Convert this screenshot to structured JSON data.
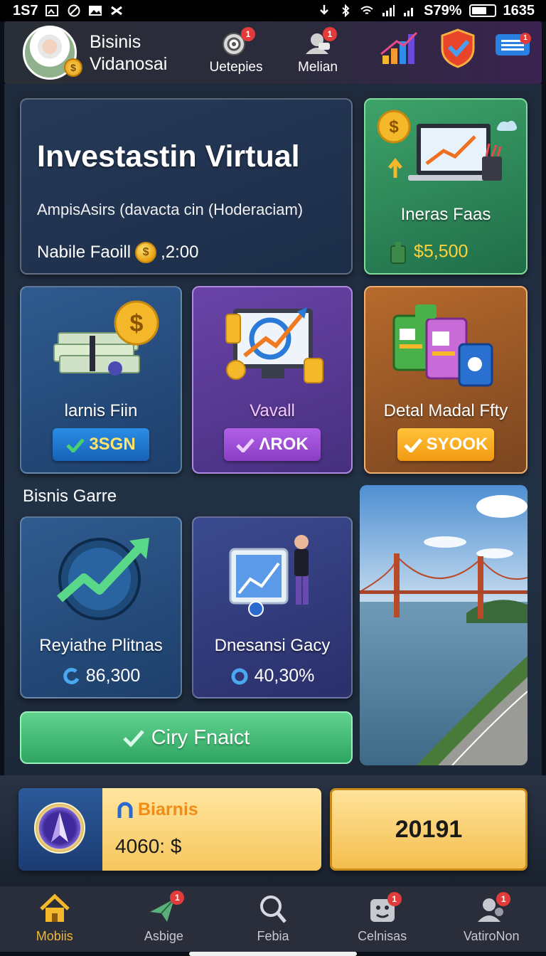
{
  "status_bar": {
    "time": "1S7",
    "battery_text": "S79%",
    "clock": "1635"
  },
  "header": {
    "user_name_line1": "Bisinis",
    "user_name_line2": "Vidanosai",
    "buttons": [
      {
        "label": "Uetepies",
        "badge": "1"
      },
      {
        "label": "Melian",
        "badge": "1"
      }
    ],
    "message_badge": "1"
  },
  "hero": {
    "title": "Investastin Virtual",
    "subtitle": "AmpisAsirs (davacta cin (Hoderaciam)",
    "balance_label": "Nabile Faoill",
    "balance_value": ",2:00"
  },
  "top_right_card": {
    "label": "Ineras Faas",
    "value": "$5,500"
  },
  "tiles": [
    {
      "label": "larnis Fiin",
      "button": "3SGN"
    },
    {
      "label": "Vavall",
      "button": "ΛROK"
    },
    {
      "label": "Detal Madal Ffty",
      "button": "SYOOK"
    }
  ],
  "section_title": "Bisnis Garre",
  "game_cards": [
    {
      "label": "Reyiathe Plitnas",
      "value": "86,300"
    },
    {
      "label": "Dnesansi Gacy",
      "value": "40,30%"
    }
  ],
  "cta_label": "Ciry Fnaict",
  "wallet": {
    "name": "Biarnis",
    "amount": "4060: $"
  },
  "score": "20191",
  "bottom_nav": [
    {
      "label": "Mobiis",
      "active": true,
      "badge": ""
    },
    {
      "label": "Asbige",
      "active": false,
      "badge": "1"
    },
    {
      "label": "Febia",
      "active": false,
      "badge": ""
    },
    {
      "label": "Celnisas",
      "active": false,
      "badge": "1"
    },
    {
      "label": "VatiroNon",
      "active": false,
      "badge": "1"
    }
  ],
  "colors": {
    "accent_gold": "#f5b82a",
    "money_green": "#3ea36a",
    "badge_red": "#e23b3b"
  }
}
